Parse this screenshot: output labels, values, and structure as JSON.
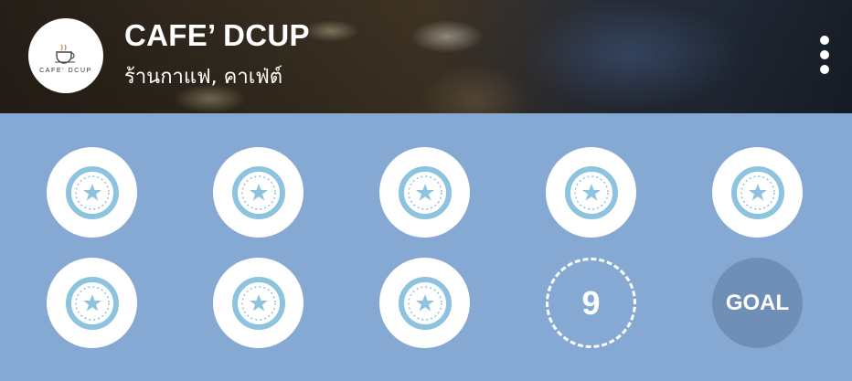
{
  "header": {
    "logo_text": "CAFE' DCUP",
    "title": "CAFE’ DCUP",
    "subtitle": "ร้านกาแฟ, คาเฟ่ต์",
    "menu_icon": "more-vertical-icon"
  },
  "stamp_card": {
    "stamped_count": 8,
    "stamp_icon": "star-stamp-icon",
    "next_slot_label": "9",
    "goal_label": "GOAL",
    "colors": {
      "background": "#85a9d3",
      "stamp_ring": "#8ec3e0",
      "goal_fill": "#6f8fb7"
    }
  }
}
